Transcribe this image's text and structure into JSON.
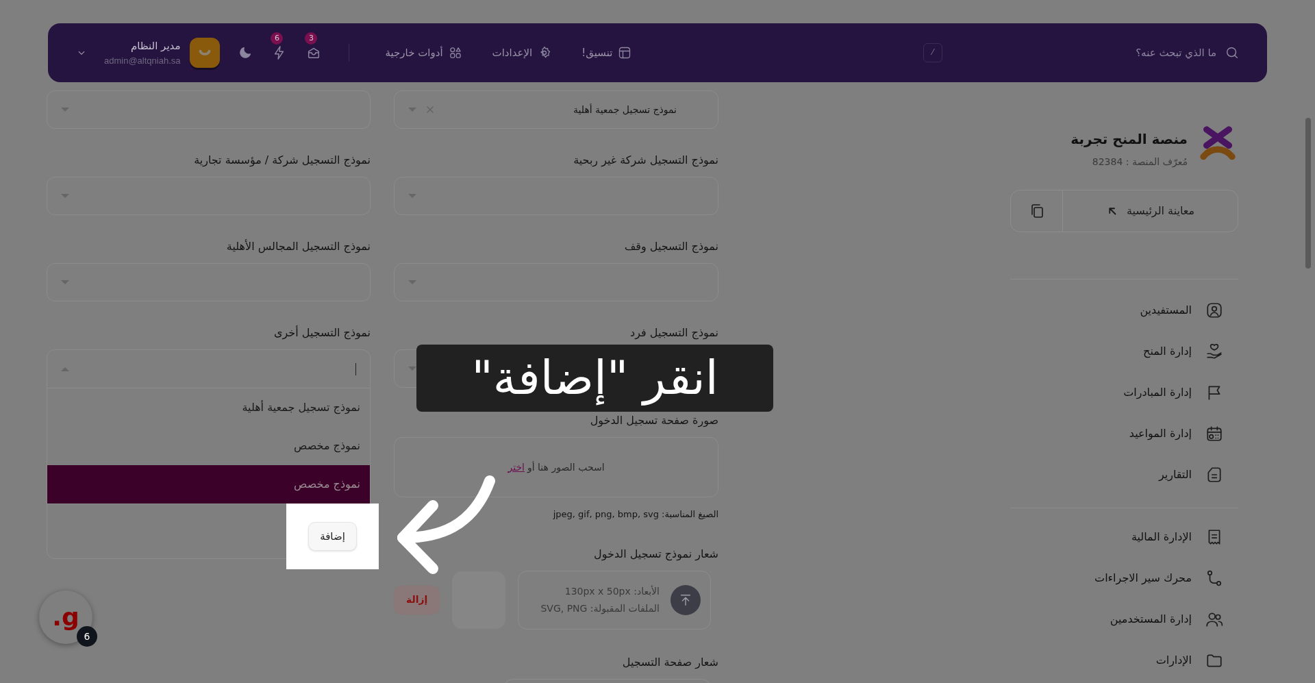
{
  "header": {
    "search": {
      "placeholder": "ما الذي تبحث عنه؟",
      "shortcut": "/"
    },
    "nav": [
      {
        "label": "تنسيق!",
        "kind": "layout"
      },
      {
        "label": "الإعدادات",
        "kind": "gear"
      },
      {
        "label": "أدوات خارجية",
        "kind": "apps"
      }
    ],
    "messages_badge": "3",
    "alerts_badge": "6",
    "user": {
      "name": "مدير النظام",
      "email": "admin@altqniah.sa"
    }
  },
  "sidebar": {
    "title": "منصة المنح تجربة",
    "platform_id": "مُعرّف المنصة : 82384",
    "preview_button": "معاينة الرئيسية",
    "groups": [
      {
        "items": [
          {
            "label": "المستفيدين",
            "kind": "user-card"
          },
          {
            "label": "إدارة المنح",
            "kind": "hand-heart"
          },
          {
            "label": "إدارة المبادرات",
            "kind": "flag"
          },
          {
            "label": "إدارة المواعيد",
            "kind": "calendar"
          },
          {
            "label": "التقارير",
            "kind": "document"
          }
        ]
      },
      {
        "items": [
          {
            "label": "الإدارة المالية",
            "kind": "receipt"
          },
          {
            "label": "محرك سير الاجراءات",
            "kind": "workflow"
          },
          {
            "label": "إدارة المستخدمين",
            "kind": "users"
          },
          {
            "label": "الإدارات",
            "kind": "folder"
          }
        ]
      }
    ]
  },
  "form": {
    "columns": [
      {
        "fields": [
          {
            "kind": "select",
            "value": "نموذج تسجيل جمعية أهلية"
          },
          {
            "kind": "select",
            "label": "نموذج التسجيل شركة غير ربحية"
          },
          {
            "kind": "select",
            "label": "نموذج التسجيل وقف"
          },
          {
            "kind": "select",
            "label": "نموذج التسجيل فرد"
          },
          {
            "kind": "dropzone",
            "label": "صورة صفحة تسجيل الدخول",
            "prompt": "اسحب الصور هنا أو",
            "link": "اختر",
            "hint": "الصيغ المناسبة: jpeg, gif, png, bmp, svg"
          },
          {
            "kind": "logo_upload",
            "label": "شعار نموذج تسجيل الدخول",
            "dimensions": "الأبعاد: 130px x 50px",
            "accepted": "الملفات المقبولة: SVG, PNG",
            "remove_button": "إزالة"
          },
          {
            "kind": "section",
            "label": "شعار صفحة التسجيل"
          }
        ]
      },
      {
        "fields": [
          {
            "kind": "select"
          },
          {
            "kind": "select",
            "label": "نموذج التسجيل شركة / مؤسسة تجارية"
          },
          {
            "kind": "select",
            "label": "نموذج التسجيل المجالس الأهلية"
          },
          {
            "kind": "open_select",
            "label": "نموذج التسجيل أخرى",
            "options": [
              {
                "label": "نموذج تسجيل جمعية أهلية",
                "selected": false
              },
              {
                "label": "نموذج مخصص",
                "selected": false
              },
              {
                "label": "نموذج مخصص",
                "selected": true
              }
            ],
            "add_button": "إضافة"
          }
        ]
      }
    ]
  },
  "callout": {
    "text": "انقر \"إضافة\""
  },
  "help_widget": {
    "letter": "g.",
    "badge": "6"
  }
}
